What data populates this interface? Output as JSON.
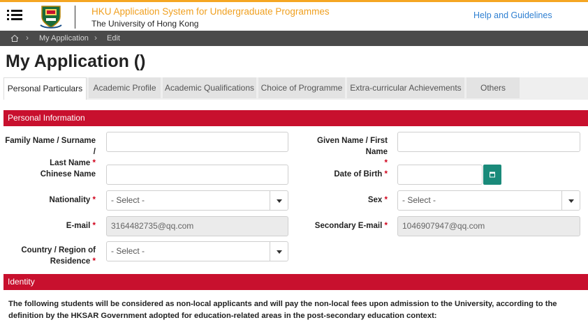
{
  "header": {
    "app_title": "HKU Application System for Undergraduate Programmes",
    "university": "The University of Hong Kong",
    "help_link": "Help and Guidelines"
  },
  "breadcrumb": {
    "items": [
      "My Application",
      "Edit"
    ]
  },
  "page": {
    "title": "My Application ()"
  },
  "tabs": [
    {
      "label": "Personal Particulars",
      "active": true
    },
    {
      "label": "Academic Profile"
    },
    {
      "label": "Academic Qualifications"
    },
    {
      "label": "Choice of Programme"
    },
    {
      "label": "Extra-curricular Achievements"
    },
    {
      "label": "Others"
    }
  ],
  "sections": {
    "personal": "Personal Information",
    "identity": "Identity"
  },
  "form": {
    "family_name_label_1": "Family Name / Surname /",
    "family_name_label_2": "Last Name",
    "given_name_label_1": "Given Name / First Name",
    "chinese_name_label": "Chinese Name",
    "dob_label": "Date of Birth",
    "nationality_label": "Nationality",
    "nationality_value": "- Select -",
    "sex_label": "Sex",
    "sex_value": "- Select -",
    "email_label": "E-mail",
    "email_value": "3164482735@qq.com",
    "secondary_email_label": "Secondary E-mail",
    "secondary_email_value": "1046907947@qq.com",
    "country_label_1": "Country / Region of",
    "country_label_2": "Residence",
    "country_value": "- Select -",
    "required_mark": "*"
  },
  "identity": {
    "note": "The following students will be considered as non-local applicants and will pay the non-local fees upon admission to the University, according to the definition by the HKSAR Government adopted for education-related areas in the post-secondary education context:"
  },
  "colors": {
    "brand_red": "#c8102e",
    "accent_orange": "#f0a020",
    "link_blue": "#2e7fd1",
    "calendar_green": "#1a8a7a"
  },
  "icons": {
    "menu": "hamburger-menu-icon",
    "logo": "hku-crest-logo",
    "home": "home-icon",
    "calendar": "calendar-icon"
  }
}
